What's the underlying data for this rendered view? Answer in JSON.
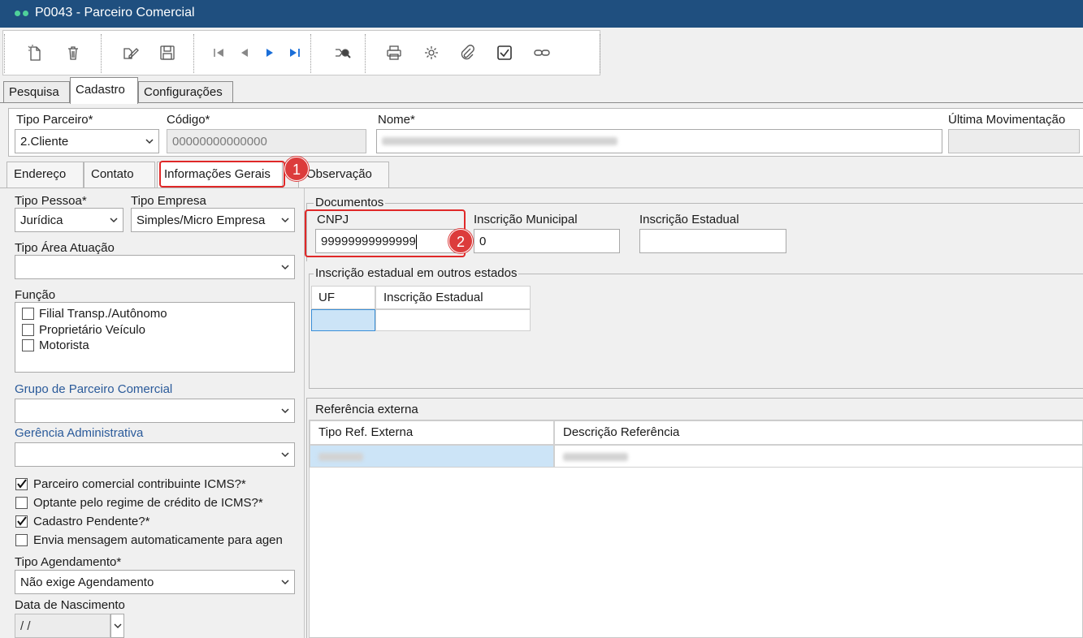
{
  "window": {
    "title": "P0043 - Parceiro Comercial"
  },
  "main_tabs": [
    "Pesquisa",
    "Cadastro",
    "Configurações"
  ],
  "header": {
    "tipo_parceiro_label": "Tipo Parceiro*",
    "tipo_parceiro_value": "2.Cliente",
    "codigo_label": "Código*",
    "codigo_value": "00000000000000",
    "nome_label": "Nome*",
    "ultima_mov_label": "Última Movimentação"
  },
  "sub_tabs": [
    "Endereço",
    "Contato",
    "Informações Gerais",
    "Observação"
  ],
  "left": {
    "tipo_pessoa_label": "Tipo Pessoa*",
    "tipo_pessoa_value": "Jurídica",
    "tipo_empresa_label": "Tipo Empresa",
    "tipo_empresa_value": "Simples/Micro Empresa",
    "tipo_area_label": "Tipo Área Atuação",
    "funcao_label": "Função",
    "funcao_items": [
      "Filial Transp./Autônomo",
      "Proprietário Veículo",
      "Motorista"
    ],
    "grupo_label": "Grupo de Parceiro Comercial",
    "gerencia_label": "Gerência Administrativa",
    "checks": [
      {
        "label": "Parceiro comercial contribuinte ICMS?*",
        "checked": true
      },
      {
        "label": "Optante pelo regime de crédito de ICMS?*",
        "checked": false
      },
      {
        "label": "Cadastro Pendente?*",
        "checked": true
      },
      {
        "label": "Envia mensagem automaticamente para agen",
        "checked": false
      }
    ],
    "tipo_agendamento_label": "Tipo Agendamento*",
    "tipo_agendamento_value": "Não exige Agendamento",
    "data_nasc_label": "Data de Nascimento",
    "data_nasc_value": " / /"
  },
  "documentos": {
    "group_label": "Documentos",
    "cnpj_label": "CNPJ",
    "cnpj_value": "99999999999999",
    "insc_mun_label": "Inscrição Municipal",
    "insc_mun_value": "0",
    "insc_est_label": "Inscrição Estadual",
    "outros_label": "Inscrição estadual em outros estados",
    "outros_cols": [
      "UF",
      "Inscrição Estadual"
    ]
  },
  "referencia": {
    "group_label": "Referência externa",
    "cols": [
      "Tipo Ref. Externa",
      "Descrição Referência"
    ]
  },
  "callouts": [
    "1",
    "2"
  ],
  "colors": {
    "titlebar": "#1f4f7f",
    "callout": "#dc3c3c",
    "selected_row": "#cce4f7"
  }
}
